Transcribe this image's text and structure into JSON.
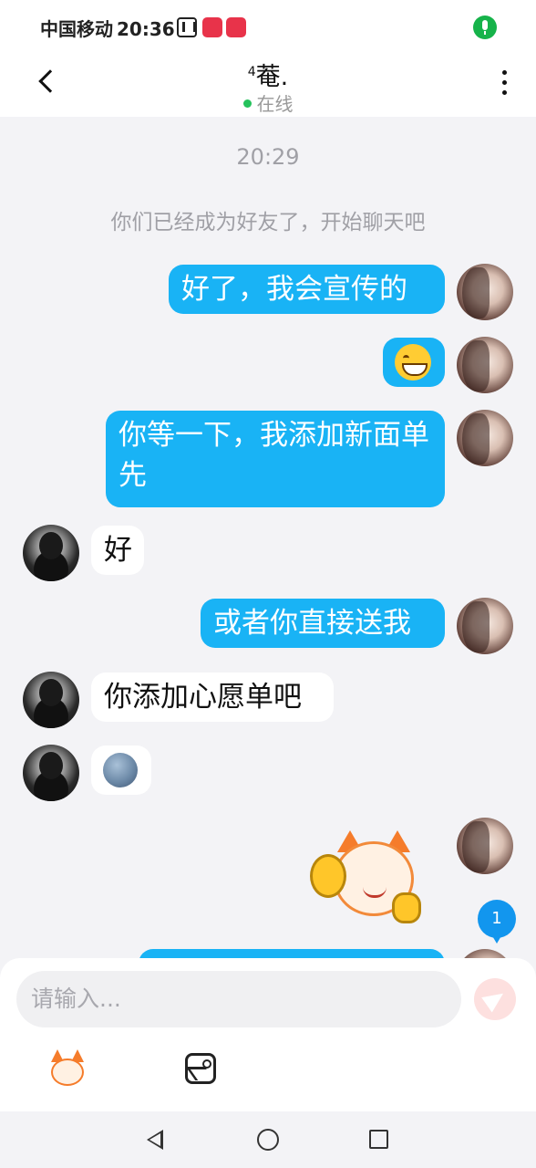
{
  "status_bar": {
    "carrier": "中国移动",
    "time": "20:36"
  },
  "header": {
    "title_prefix": "4",
    "title": "菴.",
    "status": "在线"
  },
  "chat": {
    "time_label": "20:29",
    "system_note": "你们已经成为好友了，开始聊天吧",
    "messages": [
      {
        "from": "me",
        "type": "text",
        "text": "好了，我会宣传的"
      },
      {
        "from": "me",
        "type": "emoji",
        "icon": "grinning-emoji"
      },
      {
        "from": "me",
        "type": "text",
        "text": "你等一下，我添加新面单先"
      },
      {
        "from": "them",
        "type": "text",
        "text": "好"
      },
      {
        "from": "me",
        "type": "text",
        "text": "或者你直接送我"
      },
      {
        "from": "them",
        "type": "text",
        "text": "你添加心愿单吧"
      },
      {
        "from": "them",
        "type": "emoji",
        "icon": "moon-face-emoji"
      },
      {
        "from": "me",
        "type": "sticker",
        "icon": "fox-ok-thumbs-up-sticker"
      }
    ],
    "unread_count": "1"
  },
  "input": {
    "placeholder": "请输入...",
    "send_icon": "send-icon",
    "tools": [
      "sticker-icon",
      "image-icon"
    ]
  },
  "colors": {
    "my_bubble": "#19b3f5",
    "their_bubble": "#ffffff",
    "online_dot": "#25c25c",
    "badge": "#1296ee"
  }
}
